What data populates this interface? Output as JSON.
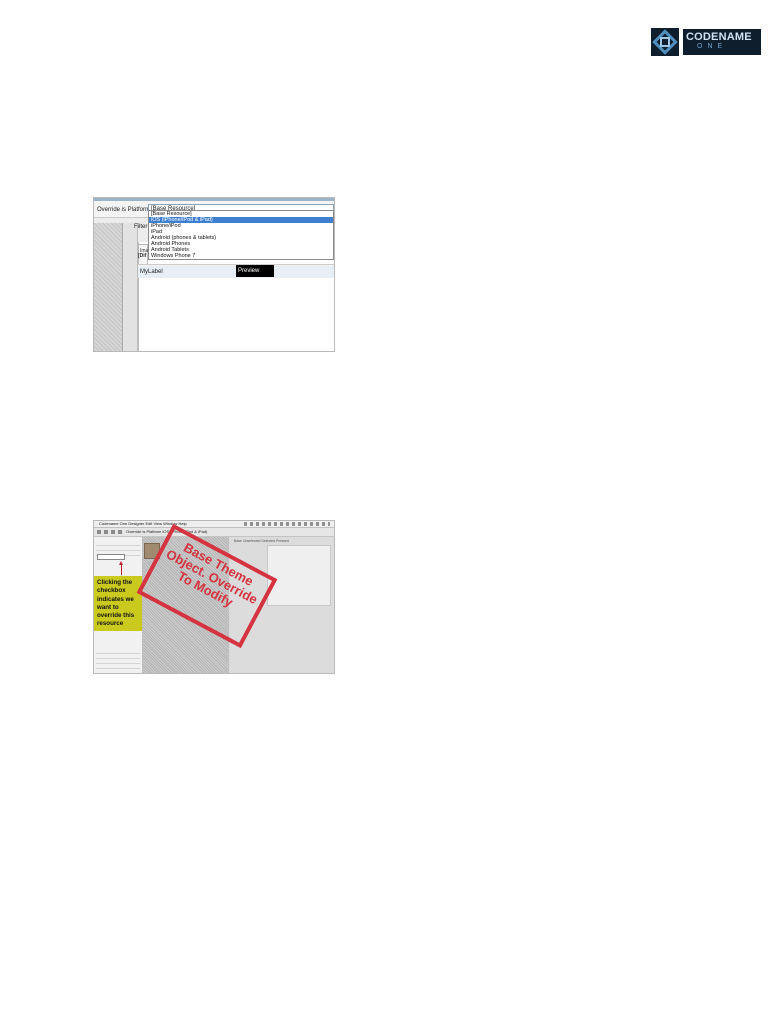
{
  "logo": {
    "word": "CODENAME",
    "sub": "ONE"
  },
  "figure1": {
    "override_label": "Override is Platform",
    "combo_value": "[Base Resource]",
    "filter_label": "Filter",
    "side_label_a": "Ima",
    "side_label_b": "[Dif",
    "row_text": "MyLabel",
    "preview_label": "Preview",
    "options": [
      {
        "label": "[Base Resource]",
        "selected": false
      },
      {
        "label": "iOS (iPhone/iPod & iPad)",
        "selected": true
      },
      {
        "label": "iPhone/iPod",
        "selected": false
      },
      {
        "label": "iPad",
        "selected": false
      },
      {
        "label": "Android (phones & tablets)",
        "selected": false
      },
      {
        "label": "Android Phones",
        "selected": false
      },
      {
        "label": "Android Tablets",
        "selected": false
      },
      {
        "label": "Windows Phone 7",
        "selected": false
      }
    ],
    "colors": {
      "selection": "#3f7fd0"
    }
  },
  "figure2": {
    "menubar_text": "Codename One Designer   Edit   View   Window   Help",
    "override_text": "Override is Platform   iOS (iPhone/iPod & iPad)",
    "right_bar_text": "Base   Unselected   Selected   Pressed",
    "callout_text": "Clicking the checkbox indicates we want to override this resource",
    "stamp_text": "Base Theme Object. Override To Modify",
    "colors": {
      "callout": "#c9c91e",
      "stamp": "#d4333f"
    }
  }
}
